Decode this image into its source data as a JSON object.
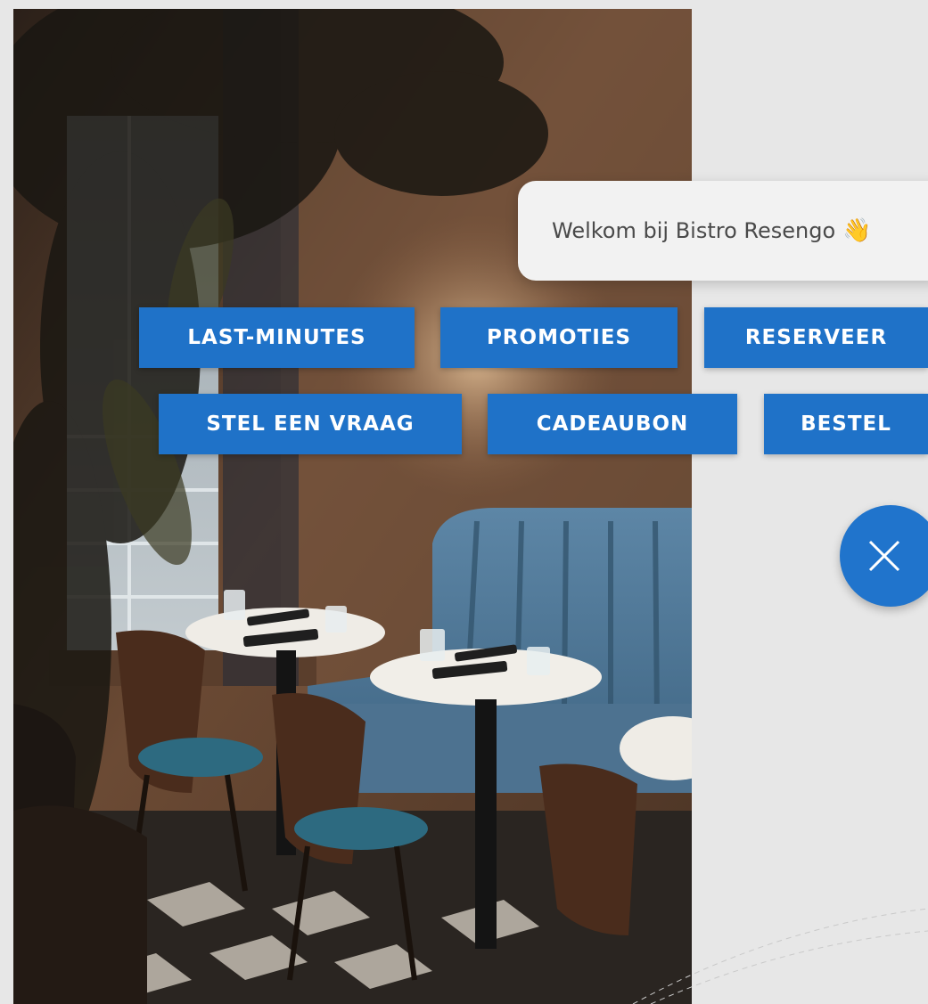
{
  "chat": {
    "greeting": "Welkom bij Bistro Resengo",
    "greeting_emoji": "👋",
    "quick_replies": [
      "LAST-MINUTES",
      "PROMOTIES",
      "RESERVEER",
      "STEL EEN VRAAG",
      "CADEAUBON",
      "BESTEL"
    ],
    "close_icon": "close-icon"
  },
  "colors": {
    "accent": "#1f72c8",
    "bubble": "#f2f2f2",
    "background": "#e7e7e7"
  }
}
